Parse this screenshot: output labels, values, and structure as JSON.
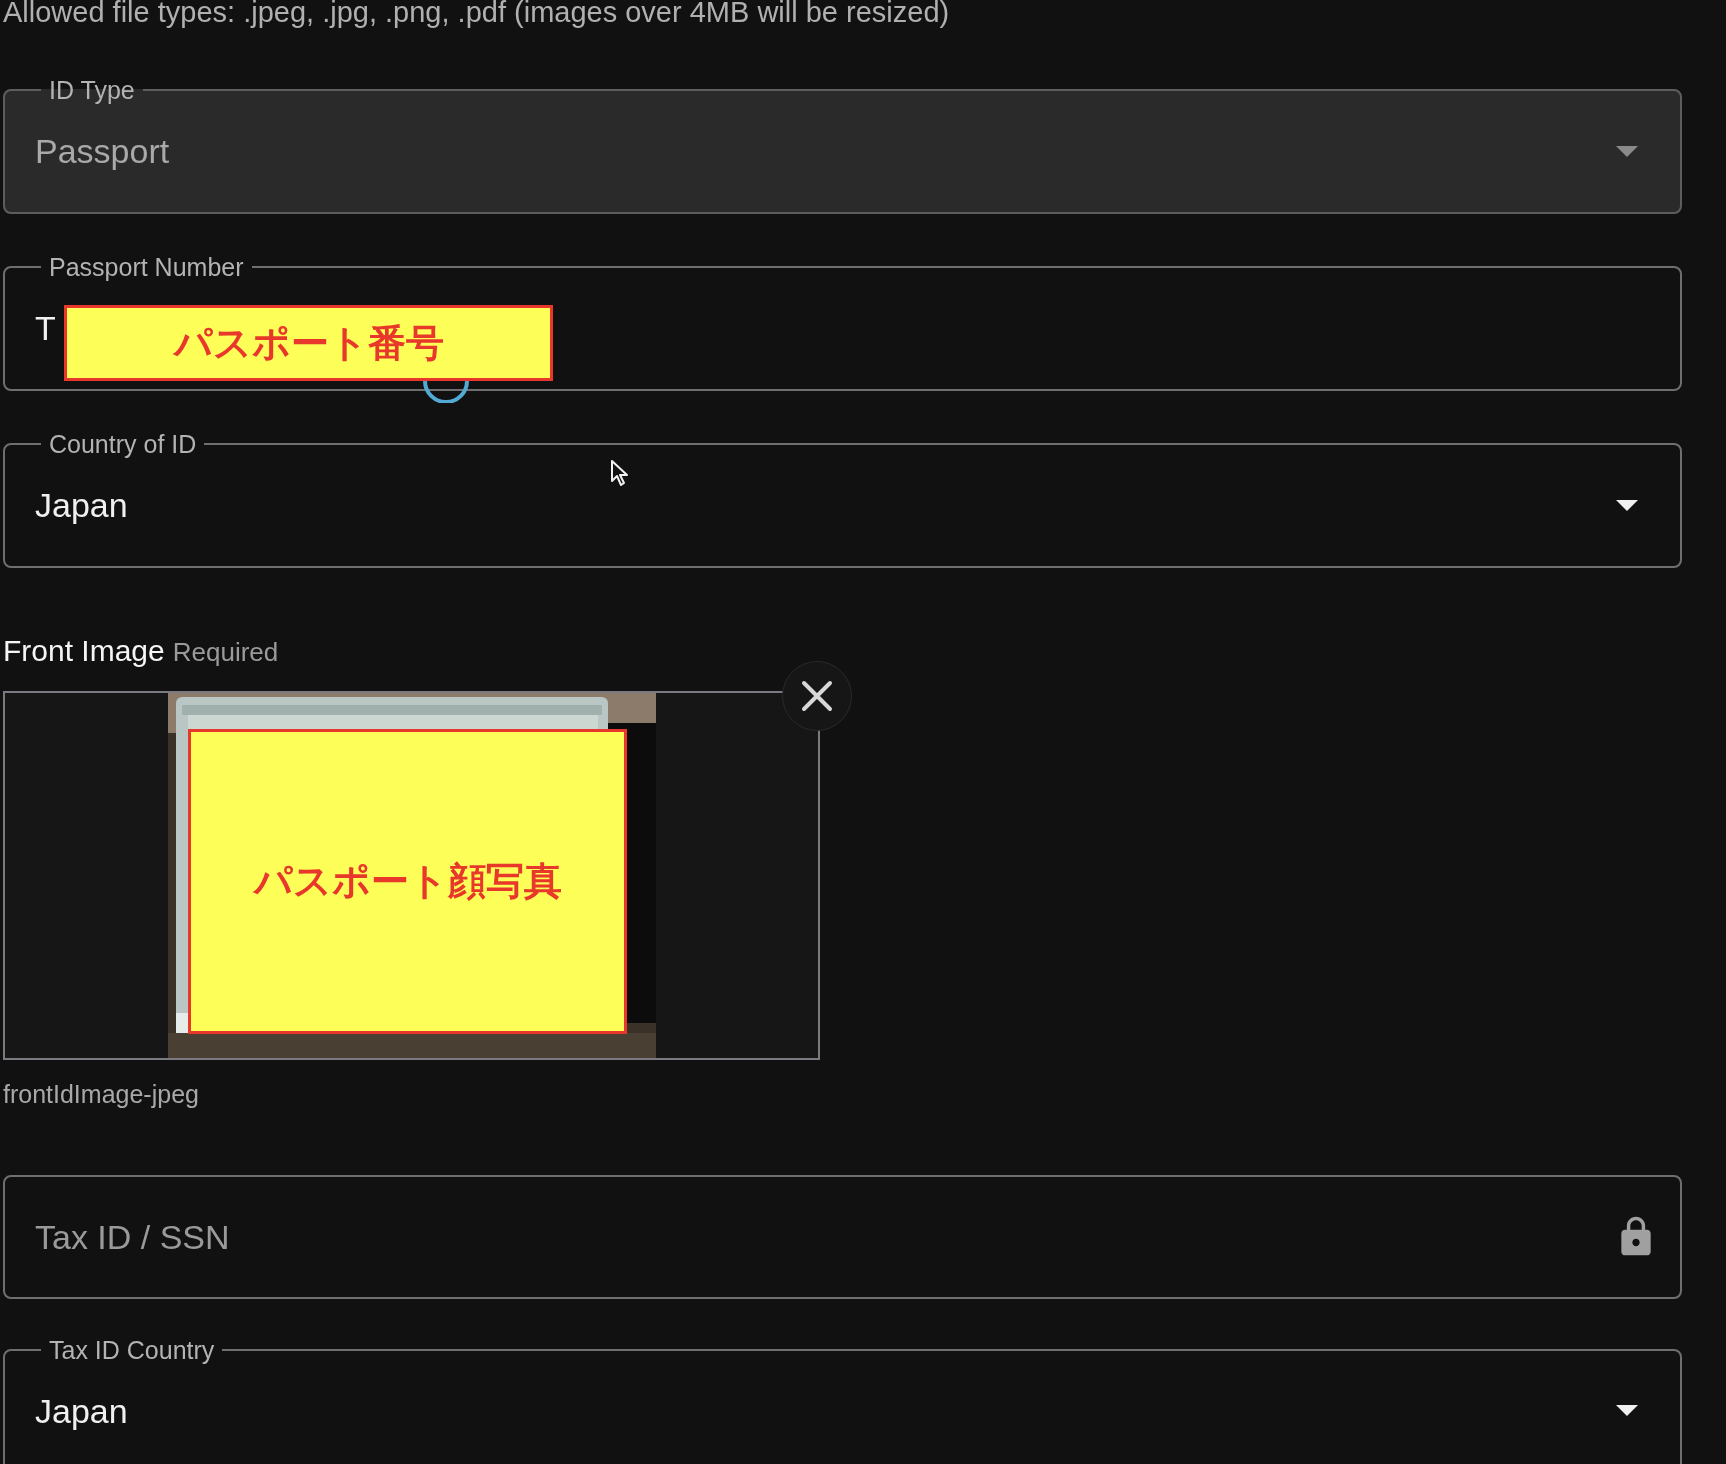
{
  "note": "Allowed file types: .jpeg, .jpg, .png, .pdf (images over 4MB will be resized)",
  "fields": [
    {
      "kind": "select",
      "label": "ID Type",
      "value": "Passport",
      "disabled": true,
      "loading": false
    },
    {
      "kind": "text",
      "label": "Passport Number",
      "value": "T",
      "disabled": false,
      "loading": true,
      "annotation": "パスポート番号"
    },
    {
      "kind": "select",
      "label": "Country of ID",
      "value": "Japan",
      "disabled": false,
      "loading": false
    }
  ],
  "front_image": {
    "label": "Front Image",
    "hint": "Required",
    "annotation": "パスポート顔写真",
    "filename": "frontIdImage-jpeg"
  },
  "tax_fields": [
    {
      "kind": "secure",
      "placeholder": "Tax ID / SSN",
      "disabled": false,
      "loading": false
    },
    {
      "kind": "select",
      "label": "Tax ID Country",
      "value": "Japan",
      "disabled": false,
      "loading": false
    }
  ]
}
